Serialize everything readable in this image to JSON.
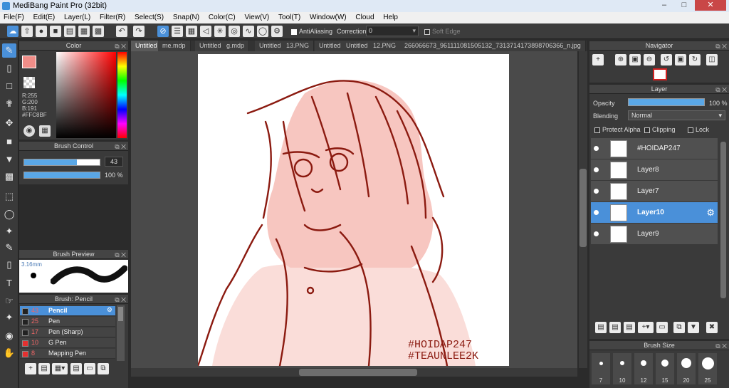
{
  "app": {
    "title": "MediBang Paint Pro (32bit)"
  },
  "menu": [
    "File(F)",
    "Edit(E)",
    "Layer(L)",
    "Filter(R)",
    "Select(S)",
    "Snap(N)",
    "Color(C)",
    "View(V)",
    "Tool(T)",
    "Window(W)",
    "Cloud",
    "Help"
  ],
  "toolbar": {
    "antialiasing_label": "AntiAliasing",
    "correction_label": "Correction",
    "correction_value": "0",
    "soft_edge_label": "Soft Edge"
  },
  "tabs": [
    "Untitled",
    "me.mdp",
    "Untitled",
    "g.mdp",
    "Untitled",
    "13.PNG",
    "Untitled",
    "Untitled",
    "12.PNG",
    "266066673_961111081505132_7313714173898706366_n.jpg"
  ],
  "color_panel": {
    "title": "Color",
    "r": "R:255",
    "g": "G:200",
    "b": "B:191",
    "hex": "#FFC8BF",
    "fg": "#f08d88",
    "picker_hue": "#ff0000"
  },
  "brush_control": {
    "title": "Brush Control",
    "size_value": "43",
    "size_fraction": 0.7,
    "opacity_value": "100 %",
    "opacity_fraction": 1.0
  },
  "brush_preview": {
    "title": "Brush Preview",
    "size_label": "3.16mm"
  },
  "brush_list": {
    "title": "Brush: Pencil",
    "items": [
      {
        "size": "43",
        "name": "Pencil",
        "swatch": "#222222",
        "selected": true
      },
      {
        "size": "25",
        "name": "Pen",
        "swatch": "#222222"
      },
      {
        "size": "17",
        "name": "Pen (Sharp)",
        "swatch": "#222222"
      },
      {
        "size": "10",
        "name": "G Pen",
        "swatch": "#e53030"
      },
      {
        "size": "8",
        "name": "Mapping Pen",
        "swatch": "#e53030"
      }
    ]
  },
  "navigator": {
    "title": "Navigator"
  },
  "layer_panel": {
    "title": "Layer",
    "opacity_label": "Opacity",
    "opacity_value": "100 %",
    "blending_label": "Blending",
    "blending_value": "Normal",
    "protect_alpha_label": "Protect Alpha",
    "clipping_label": "Clipping",
    "lock_label": "Lock",
    "layers": [
      {
        "name": "#HOIDAP247"
      },
      {
        "name": "Layer8"
      },
      {
        "name": "Layer7"
      },
      {
        "name": "Layer10",
        "selected": true
      },
      {
        "name": "Layer9"
      }
    ]
  },
  "brush_size_panel": {
    "title": "Brush Size",
    "sizes": [
      "7",
      "10",
      "12",
      "15",
      "20",
      "25"
    ]
  },
  "canvas": {
    "watermark_line1": "#HOIDAP247",
    "watermark_line2": "#TEAUNLEE2K",
    "line_color": "#8b1a10",
    "fill_color": "#f7c6c0"
  },
  "icons": {
    "close": "close-icon",
    "minimize": "minimize-icon",
    "maximize": "maximize-icon"
  }
}
